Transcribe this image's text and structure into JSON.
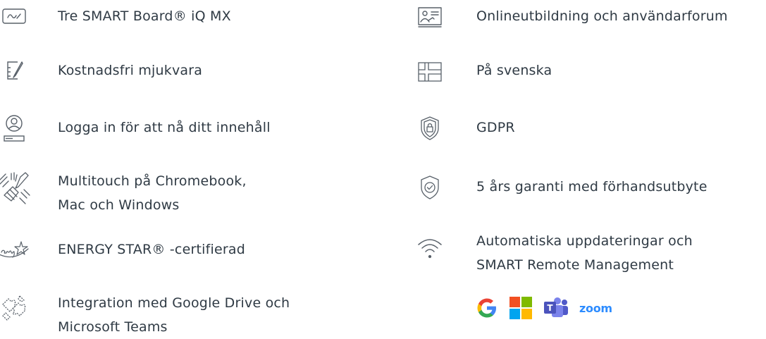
{
  "features_left": [
    {
      "icon": "whiteboard-icon",
      "lines": [
        "Tre SMART Board® iQ MX"
      ]
    },
    {
      "icon": "pen-tablet-icon",
      "lines": [
        "Kostnadsfri mjukvara"
      ]
    },
    {
      "icon": "user-login-icon",
      "lines": [
        "Logga in för att nå ditt innehåll"
      ]
    },
    {
      "icon": "multitouch-hands-icon",
      "lines": [
        "Multitouch på Chromebook,",
        "Mac och Windows"
      ]
    },
    {
      "icon": "energy-star-icon",
      "lines": [
        "ENERGY STAR® -certifierad"
      ]
    },
    {
      "icon": "puzzle-pieces-icon",
      "lines": [
        "Integration med Google Drive och",
        "Microsoft Teams"
      ]
    }
  ],
  "features_right": [
    {
      "icon": "online-training-icon",
      "lines": [
        "Onlineutbildning och användarforum"
      ]
    },
    {
      "icon": "swedish-flag-icon",
      "lines": [
        "På svenska"
      ]
    },
    {
      "icon": "shield-lock-icon",
      "lines": [
        "GDPR"
      ]
    },
    {
      "icon": "shield-check-icon",
      "lines": [
        "5 års garanti med förhandsutbyte"
      ]
    },
    {
      "icon": "wifi-icon",
      "lines": [
        "Automatiska uppdateringar och",
        "SMART Remote Management"
      ]
    }
  ],
  "partner_logos": {
    "google": "G",
    "teams": "T",
    "zoom": "zoom"
  },
  "colors": {
    "text": "#2f3a44",
    "icon": "#586069",
    "google_blue": "#4285F4",
    "google_red": "#EA4335",
    "google_yellow": "#FBBC05",
    "google_green": "#34A853",
    "ms_red": "#F25022",
    "ms_green": "#7FBA00",
    "ms_blue": "#00A4EF",
    "ms_yellow": "#FFB900",
    "teams_purple": "#5059C9",
    "zoom_blue": "#2D8CFF"
  }
}
